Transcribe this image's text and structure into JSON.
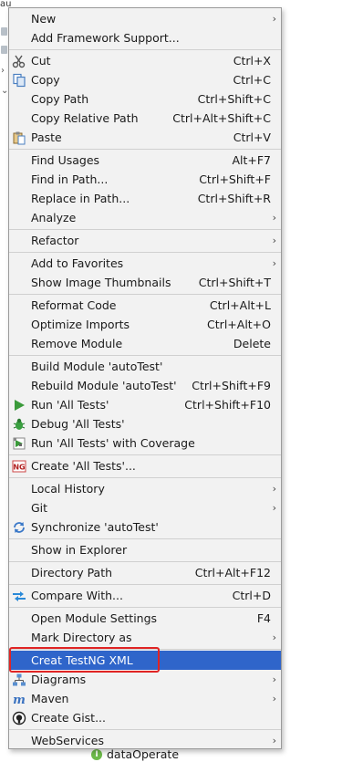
{
  "background": {
    "title_fragment": "au",
    "module_item": "dataOperate"
  },
  "menu": {
    "items": [
      {
        "label": "New",
        "shortcut": "",
        "submenu": true
      },
      {
        "label": "Add Framework Support...",
        "shortcut": "",
        "submenu": false
      },
      {
        "label": "Cut",
        "shortcut": "Ctrl+X",
        "submenu": false,
        "icon": "scissors-icon"
      },
      {
        "label": "Copy",
        "shortcut": "Ctrl+C",
        "submenu": false,
        "icon": "copy-icon"
      },
      {
        "label": "Copy Path",
        "shortcut": "Ctrl+Shift+C",
        "submenu": false
      },
      {
        "label": "Copy Relative Path",
        "shortcut": "Ctrl+Alt+Shift+C",
        "submenu": false
      },
      {
        "label": "Paste",
        "shortcut": "Ctrl+V",
        "submenu": false,
        "icon": "paste-icon"
      },
      {
        "label": "Find Usages",
        "shortcut": "Alt+F7",
        "submenu": false
      },
      {
        "label": "Find in Path...",
        "shortcut": "Ctrl+Shift+F",
        "submenu": false
      },
      {
        "label": "Replace in Path...",
        "shortcut": "Ctrl+Shift+R",
        "submenu": false
      },
      {
        "label": "Analyze",
        "shortcut": "",
        "submenu": true
      },
      {
        "label": "Refactor",
        "shortcut": "",
        "submenu": true
      },
      {
        "label": "Add to Favorites",
        "shortcut": "",
        "submenu": true
      },
      {
        "label": "Show Image Thumbnails",
        "shortcut": "Ctrl+Shift+T",
        "submenu": false
      },
      {
        "label": "Reformat Code",
        "shortcut": "Ctrl+Alt+L",
        "submenu": false
      },
      {
        "label": "Optimize Imports",
        "shortcut": "Ctrl+Alt+O",
        "submenu": false
      },
      {
        "label": "Remove Module",
        "shortcut": "Delete",
        "submenu": false
      },
      {
        "label": "Build Module 'autoTest'",
        "shortcut": "",
        "submenu": false
      },
      {
        "label": "Rebuild Module 'autoTest'",
        "shortcut": "Ctrl+Shift+F9",
        "submenu": false
      },
      {
        "label": "Run 'All Tests'",
        "shortcut": "Ctrl+Shift+F10",
        "submenu": false,
        "icon": "run-icon"
      },
      {
        "label": "Debug 'All Tests'",
        "shortcut": "",
        "submenu": false,
        "icon": "debug-icon"
      },
      {
        "label": "Run 'All Tests' with Coverage",
        "shortcut": "",
        "submenu": false,
        "icon": "coverage-icon"
      },
      {
        "label": "Create 'All Tests'...",
        "shortcut": "",
        "submenu": false,
        "icon": "testng-icon"
      },
      {
        "label": "Local History",
        "shortcut": "",
        "submenu": true
      },
      {
        "label": "Git",
        "shortcut": "",
        "submenu": true
      },
      {
        "label": "Synchronize 'autoTest'",
        "shortcut": "",
        "submenu": false,
        "icon": "sync-icon"
      },
      {
        "label": "Show in Explorer",
        "shortcut": "",
        "submenu": false
      },
      {
        "label": "Directory Path",
        "shortcut": "Ctrl+Alt+F12",
        "submenu": false
      },
      {
        "label": "Compare With...",
        "shortcut": "Ctrl+D",
        "submenu": false,
        "icon": "compare-icon"
      },
      {
        "label": "Open Module Settings",
        "shortcut": "F4",
        "submenu": false
      },
      {
        "label": "Mark Directory as",
        "shortcut": "",
        "submenu": true
      },
      {
        "label": "Creat TestNG XML",
        "shortcut": "",
        "submenu": false,
        "selected": true
      },
      {
        "label": "Diagrams",
        "shortcut": "",
        "submenu": true,
        "icon": "diagram-icon"
      },
      {
        "label": "Maven",
        "shortcut": "",
        "submenu": true,
        "icon": "maven-icon"
      },
      {
        "label": "Create Gist...",
        "shortcut": "",
        "submenu": false,
        "icon": "github-icon"
      },
      {
        "label": "WebServices",
        "shortcut": "",
        "submenu": true
      }
    ],
    "submenu_arrow": "›",
    "colors": {
      "selected_bg": "#2f65ca",
      "highlight_border": "#e02424",
      "menu_bg": "#f2f2f2"
    }
  }
}
